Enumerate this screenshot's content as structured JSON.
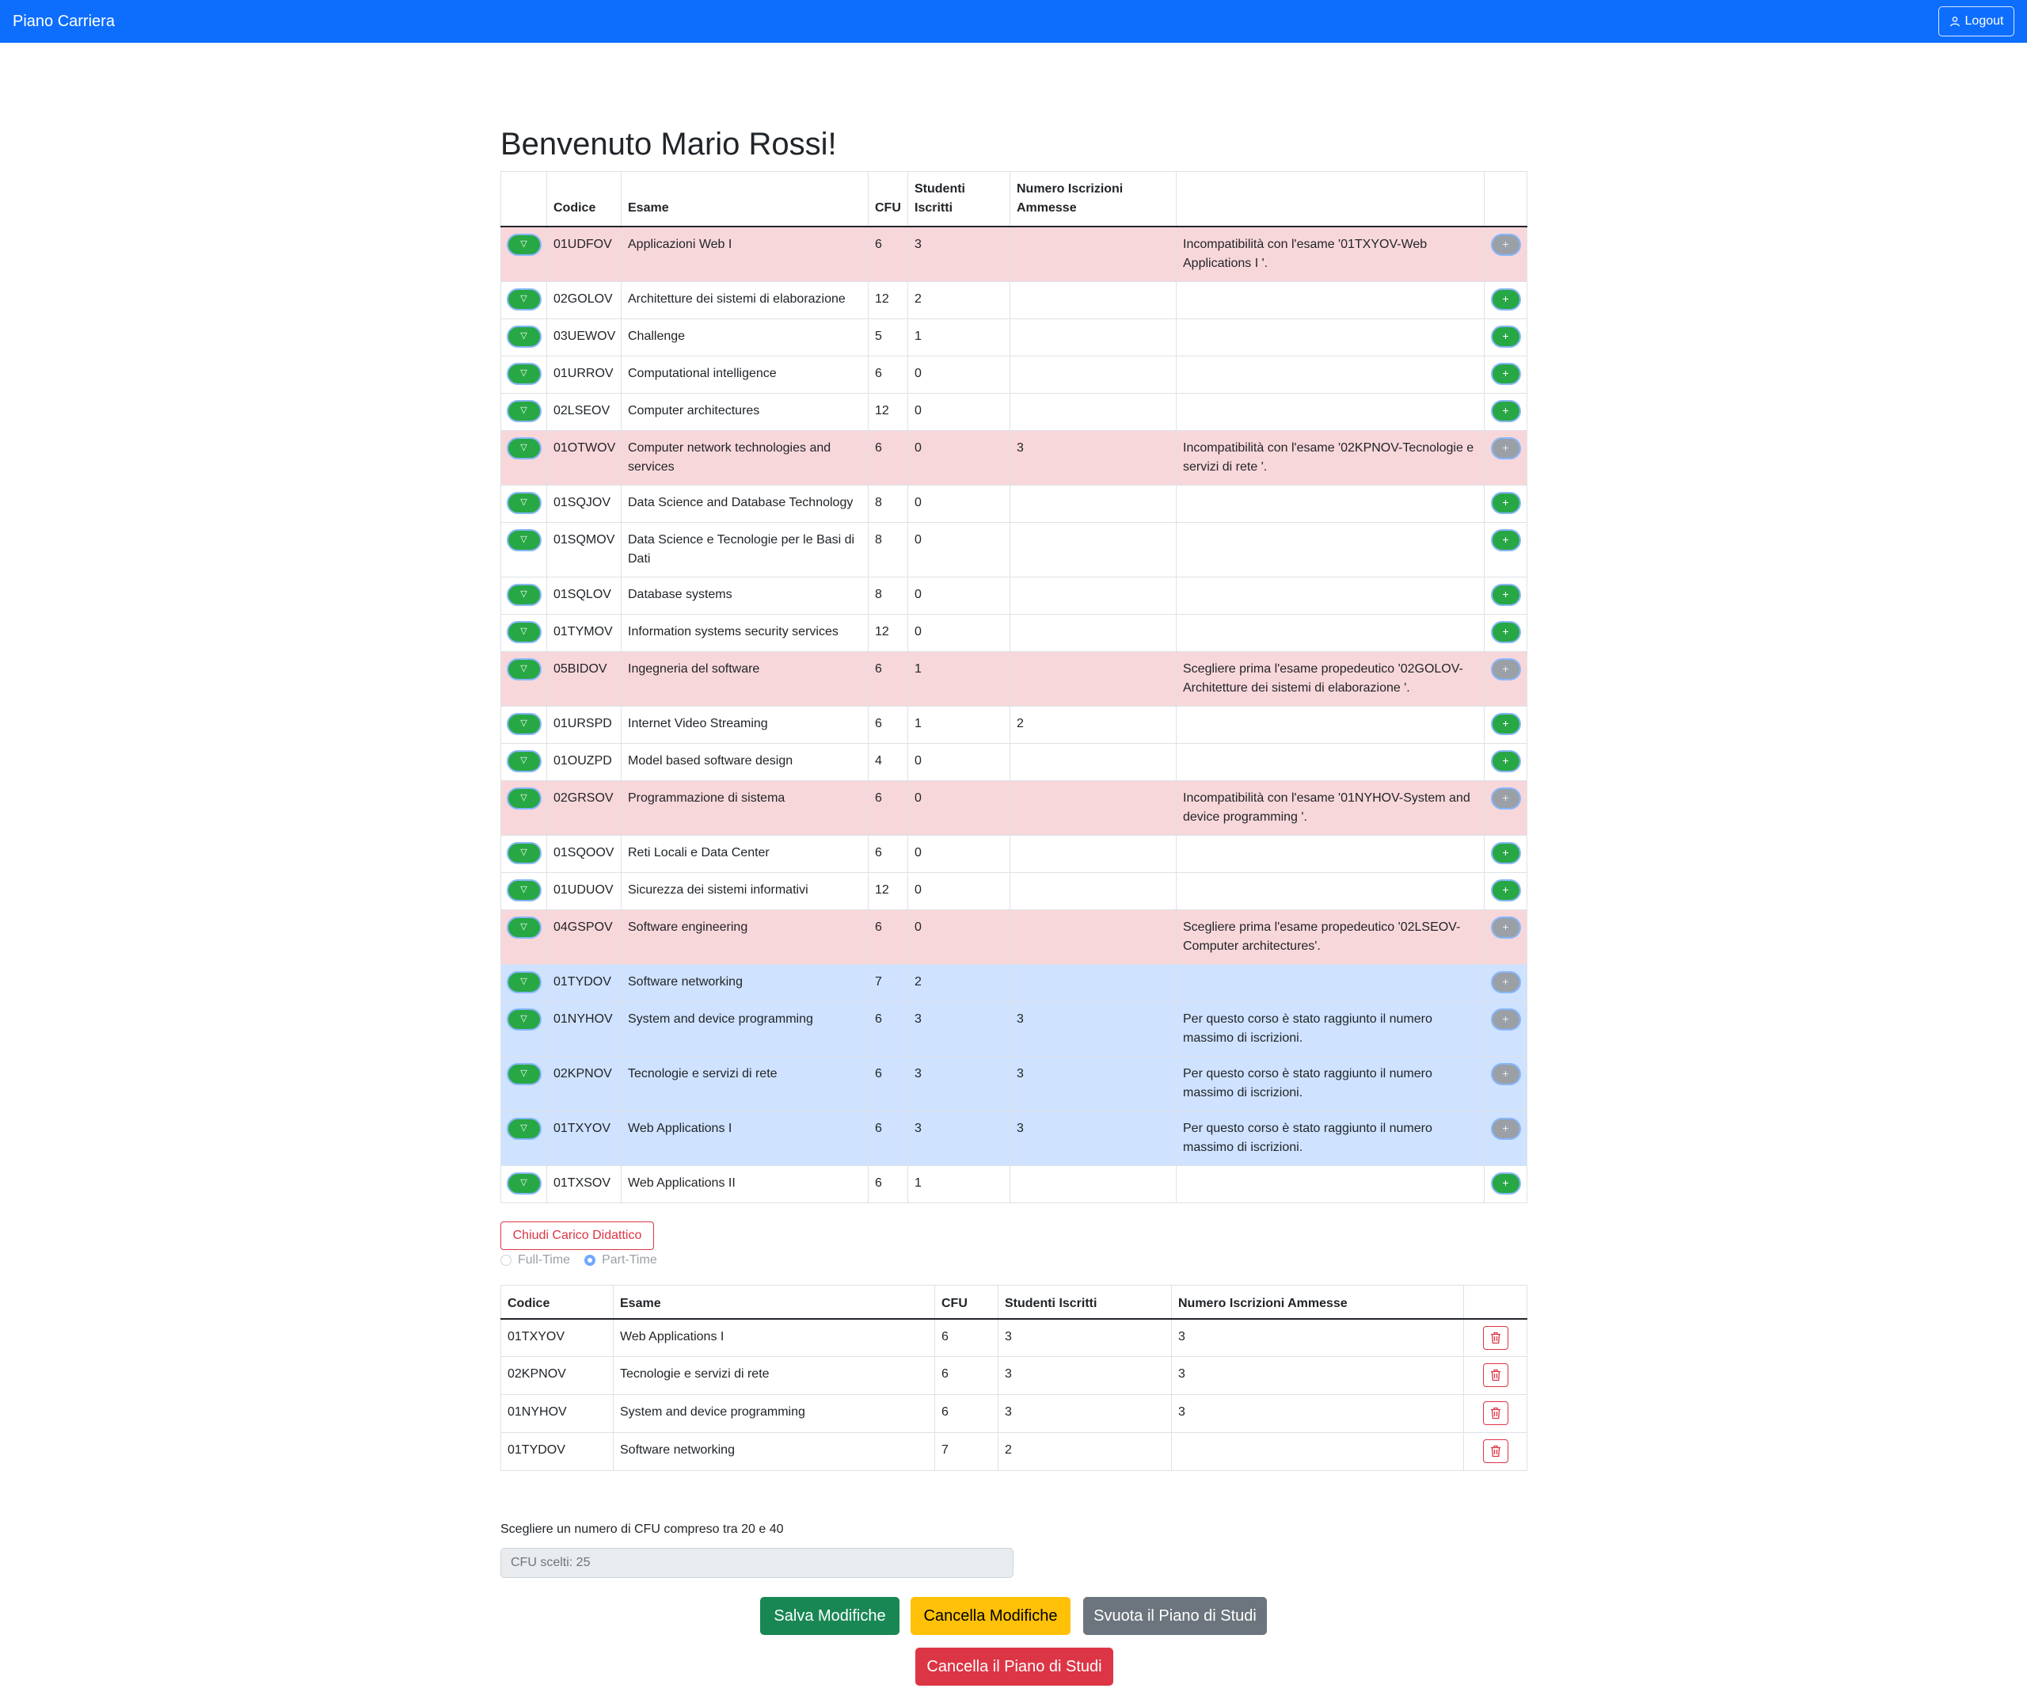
{
  "navbar": {
    "brand": "Piano Carriera",
    "logout_label": "Logout"
  },
  "title": "Benvenuto Mario Rossi!",
  "exams_table": {
    "headers": {
      "codice": "Codice",
      "esame": "Esame",
      "cfu": "CFU",
      "studenti": "Studenti Iscritti",
      "numero": "Numero Iscrizioni Ammesse"
    },
    "expand_symbol": "▽",
    "add_symbol": "+",
    "rows": [
      {
        "code": "01UDFOV",
        "name": "Applicazioni Web I",
        "cfu": "6",
        "students": "3",
        "max": "",
        "note": "Incompatibilità con l'esame '01TXYOV-Web Applications I '."
      },
      {
        "code": "02GOLOV",
        "name": "Architetture dei sistemi di elaborazione",
        "cfu": "12",
        "students": "2",
        "max": "",
        "note": ""
      },
      {
        "code": "03UEWOV",
        "name": "Challenge",
        "cfu": "5",
        "students": "1",
        "max": "",
        "note": ""
      },
      {
        "code": "01URROV",
        "name": "Computational intelligence",
        "cfu": "6",
        "students": "0",
        "max": "",
        "note": ""
      },
      {
        "code": "02LSEOV",
        "name": "Computer architectures",
        "cfu": "12",
        "students": "0",
        "max": "",
        "note": ""
      },
      {
        "code": "01OTWOV",
        "name": "Computer network technologies and services",
        "cfu": "6",
        "students": "0",
        "max": "3",
        "note": "Incompatibilità con l'esame '02KPNOV-Tecnologie e servizi di rete '."
      },
      {
        "code": "01SQJOV",
        "name": "Data Science and Database Technology",
        "cfu": "8",
        "students": "0",
        "max": "",
        "note": ""
      },
      {
        "code": "01SQMOV",
        "name": "Data Science e Tecnologie per le Basi di Dati",
        "cfu": "8",
        "students": "0",
        "max": "",
        "note": ""
      },
      {
        "code": "01SQLOV",
        "name": "Database systems",
        "cfu": "8",
        "students": "0",
        "max": "",
        "note": ""
      },
      {
        "code": "01TYMOV",
        "name": "Information systems security services",
        "cfu": "12",
        "students": "0",
        "max": "",
        "note": ""
      },
      {
        "code": "05BIDOV",
        "name": "Ingegneria del software",
        "cfu": "6",
        "students": "1",
        "max": "",
        "note": "Scegliere prima l'esame propedeutico '02GOLOV-Architetture dei sistemi di elaborazione '."
      },
      {
        "code": "01URSPD",
        "name": "Internet Video Streaming",
        "cfu": "6",
        "students": "1",
        "max": "2",
        "note": ""
      },
      {
        "code": "01OUZPD",
        "name": "Model based software design",
        "cfu": "4",
        "students": "0",
        "max": "",
        "note": ""
      },
      {
        "code": "02GRSOV",
        "name": "Programmazione di sistema",
        "cfu": "6",
        "students": "0",
        "max": "",
        "note": "Incompatibilità con l'esame '01NYHOV-System and device programming '."
      },
      {
        "code": "01SQOOV",
        "name": "Reti Locali e Data Center",
        "cfu": "6",
        "students": "0",
        "max": "",
        "note": ""
      },
      {
        "code": "01UDUOV",
        "name": "Sicurezza dei sistemi informativi",
        "cfu": "12",
        "students": "0",
        "max": "",
        "note": ""
      },
      {
        "code": "04GSPOV",
        "name": "Software engineering",
        "cfu": "6",
        "students": "0",
        "max": "",
        "note": "Scegliere prima l'esame propedeutico '02LSEOV-Computer architectures'."
      },
      {
        "code": "01TYDOV",
        "name": "Software networking",
        "cfu": "7",
        "students": "2",
        "max": "",
        "note": ""
      },
      {
        "code": "01NYHOV",
        "name": "System and device programming",
        "cfu": "6",
        "students": "3",
        "max": "3",
        "note": "Per questo corso è stato raggiunto il numero massimo di iscrizioni."
      },
      {
        "code": "02KPNOV",
        "name": "Tecnologie e servizi di rete",
        "cfu": "6",
        "students": "3",
        "max": "3",
        "note": "Per questo corso è stato raggiunto il numero massimo di iscrizioni."
      },
      {
        "code": "01TXYOV",
        "name": "Web Applications I",
        "cfu": "6",
        "students": "3",
        "max": "3",
        "note": "Per questo corso è stato raggiunto il numero massimo di iscrizioni."
      },
      {
        "code": "01TXSOV",
        "name": "Web Applications II",
        "cfu": "6",
        "students": "1",
        "max": "",
        "note": ""
      }
    ],
    "row_status": [
      "red",
      "none",
      "none",
      "none",
      "none",
      "red",
      "none",
      "none",
      "none",
      "none",
      "red",
      "none",
      "none",
      "red",
      "none",
      "none",
      "red",
      "blue",
      "blue",
      "blue",
      "blue",
      "none"
    ]
  },
  "study_plan": {
    "close_button": "Chiudi Carico Didattico",
    "radio_full": "Full-Time",
    "radio_part": "Part-Time",
    "headers": {
      "codice": "Codice",
      "esame": "Esame",
      "cfu": "CFU",
      "studenti": "Studenti Iscritti",
      "numero": "Numero Iscrizioni Ammesse"
    },
    "rows": [
      {
        "code": "01TXYOV",
        "name": "Web Applications I",
        "cfu": "6",
        "students": "3",
        "max": "3"
      },
      {
        "code": "02KPNOV",
        "name": "Tecnologie e servizi di rete",
        "cfu": "6",
        "students": "3",
        "max": "3"
      },
      {
        "code": "01NYHOV",
        "name": "System and device programming",
        "cfu": "6",
        "students": "3",
        "max": "3"
      },
      {
        "code": "01TYDOV",
        "name": "Software networking",
        "cfu": "7",
        "students": "2",
        "max": ""
      }
    ],
    "cfu_hint": "Scegliere un numero di CFU compreso tra 20 e 40",
    "cfu_value": "CFU scelti: 25"
  },
  "actions": {
    "save": "Salva Modifiche",
    "cancel": "Cancella Modifiche",
    "empty": "Svuota il Piano di Studi",
    "delete": "Cancella il Piano di Studi"
  },
  "colors": {
    "primary": "#0d6efd",
    "success": "#198754",
    "warning": "#ffc107",
    "secondary": "#6c757d",
    "danger": "#dc3545",
    "row_incompatible": "#f8d7da",
    "row_selected": "#cfe2ff"
  }
}
